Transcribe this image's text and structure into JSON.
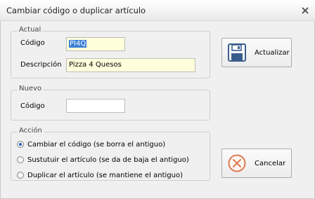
{
  "window": {
    "title": "Cambiar código o duplicar artículo"
  },
  "actual": {
    "legend": "Actual",
    "codigo_label": "Código",
    "codigo_value": "PI4Q",
    "descripcion_label": "Descripción",
    "descripcion_value": "Pizza 4 Quesos"
  },
  "nuevo": {
    "legend": "Nuevo",
    "codigo_label": "Código",
    "codigo_value": ""
  },
  "accion": {
    "legend": "Acción",
    "options": [
      {
        "label": "Cambiar el código (se borra el antiguo)",
        "selected": true
      },
      {
        "label": "Sustutuir el artículo (se da de baja el antiguo)",
        "selected": false
      },
      {
        "label": "Duplicar el artículo (se mantiene el antiguo)",
        "selected": false
      }
    ]
  },
  "buttons": {
    "actualizar": {
      "label": "Actualizar",
      "icon": "floppy-disk-icon"
    },
    "cancelar": {
      "label": "Cancelar",
      "icon": "cancel-circle-icon"
    }
  },
  "colors": {
    "field_yellow": "#ffffdc",
    "selection_blue": "#3a80d7",
    "cancel_orange": "#e07a52",
    "save_blue": "#3a5e8c"
  }
}
